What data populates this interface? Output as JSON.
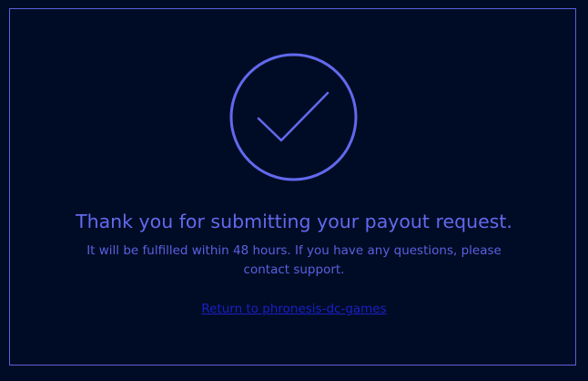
{
  "confirmation": {
    "title": "Thank you for submitting your payout request.",
    "message": "It will be fulfilled within 48 hours. If you have any questions, please contact support.",
    "return_link": "Return to phronesis-dc-games",
    "icon": "checkmark-circle-icon"
  },
  "colors": {
    "background": "#000c25",
    "accent": "#6269ee",
    "link": "#1a1fc8"
  }
}
